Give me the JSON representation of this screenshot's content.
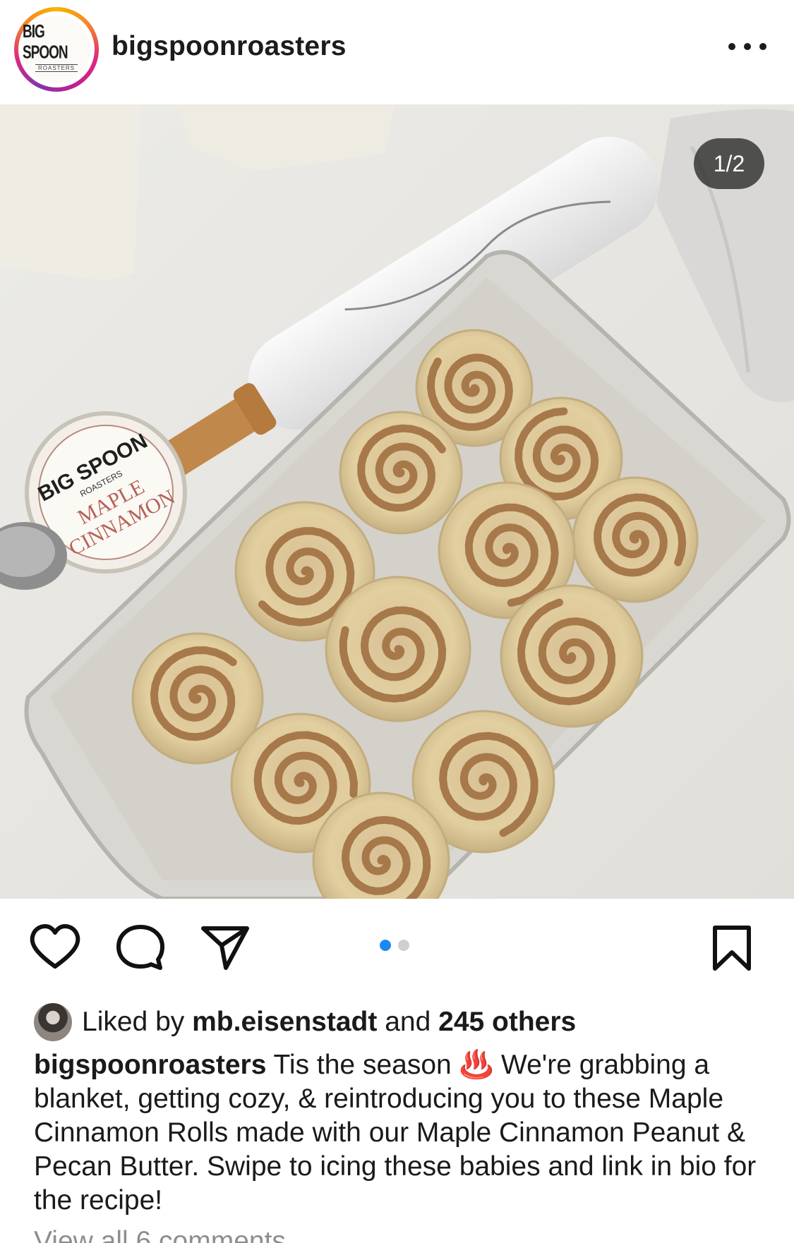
{
  "header": {
    "avatar": {
      "logo_text": "BIG SPOON",
      "logo_subtext": "ROASTERS"
    },
    "username": "bigspoonroasters",
    "more_icon": "more-horizontal-icon"
  },
  "post": {
    "image_counter": "1/2",
    "jar_label": {
      "brand": "BIG SPOON",
      "sub": "ROASTERS",
      "line1": "MAPLE",
      "line2": "CINNAMON"
    },
    "carousel": {
      "total": 2,
      "current": 1
    },
    "colors": {
      "active_dot": "#1f87f5",
      "inactive_dot": "#cfcfcf"
    }
  },
  "actions": {
    "like_icon": "heart-icon",
    "comment_icon": "comment-bubble-icon",
    "share_icon": "paper-plane-icon",
    "save_icon": "bookmark-icon"
  },
  "likes": {
    "prefix": "Liked by",
    "user": "mb.eisenstadt",
    "middle": "and",
    "others": "245 others"
  },
  "caption": {
    "username": "bigspoonroasters",
    "text_before_emoji": "Tis the season",
    "emoji": "♨️",
    "text_after_emoji": "We're grabbing a blanket, getting cozy, & reintroducing you to these Maple Cinnamon Rolls made with our Maple Cinnamon Peanut & Pecan Butter. Swipe to icing these babies and link in bio for the recipe!"
  },
  "comments": {
    "view_all": "View all 6 comments"
  }
}
